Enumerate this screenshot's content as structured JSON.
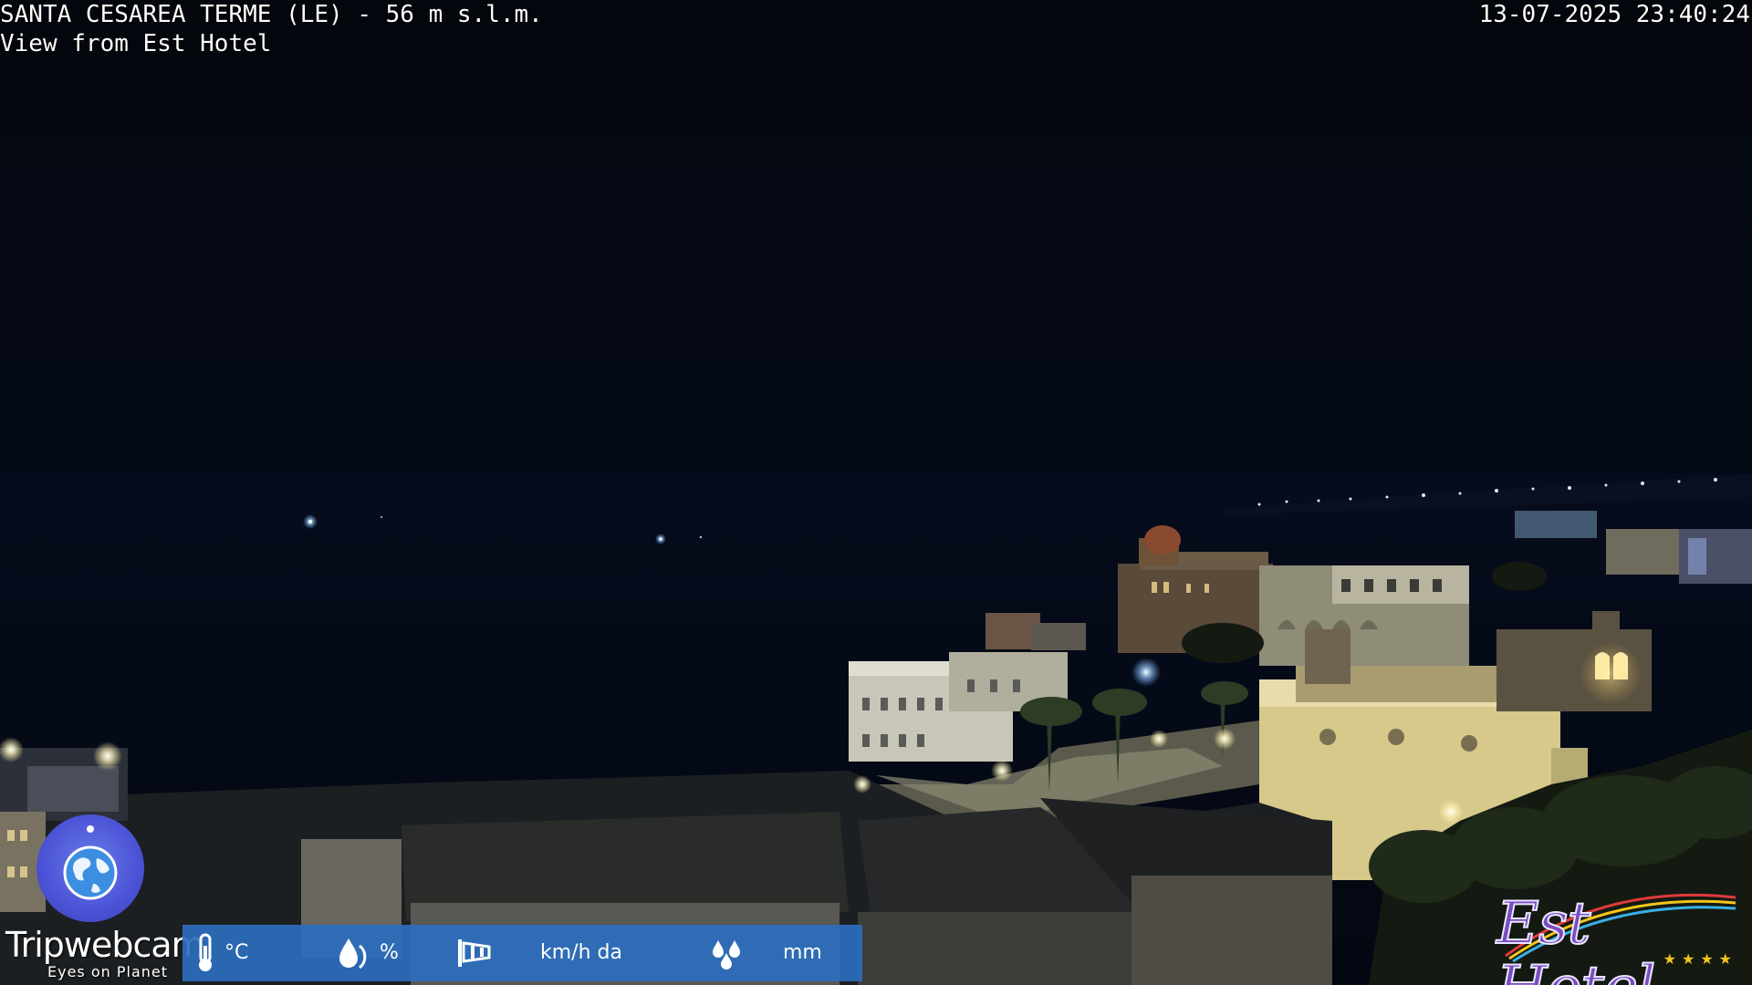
{
  "overlay": {
    "title": "SANTA CESAREA TERME (LE) - 56 m s.l.m.",
    "subtitle": "View from Est Hotel",
    "datetime": "13-07-2025 23:40:24"
  },
  "watermark": {
    "brand": "Tripwebcam",
    "tagline": "Eyes on Planet",
    "badge_icon": "globe-icon",
    "badge_color": "#4b53d6"
  },
  "weather_bar": {
    "background": "#2d6ebe",
    "temperature": {
      "icon": "thermometer-icon",
      "unit": "°C"
    },
    "humidity": {
      "icon": "water-drop-icon",
      "unit": "%"
    },
    "wind": {
      "icon": "windsock-icon",
      "unit": "km/h da"
    },
    "rain": {
      "icon": "rain-drops-icon",
      "unit": "mm"
    }
  },
  "hotel_logo": {
    "text": "Est Hotel",
    "stars": "★★★★",
    "colors": {
      "text": "#7a4bc0",
      "stars": "#f2c51a"
    }
  }
}
